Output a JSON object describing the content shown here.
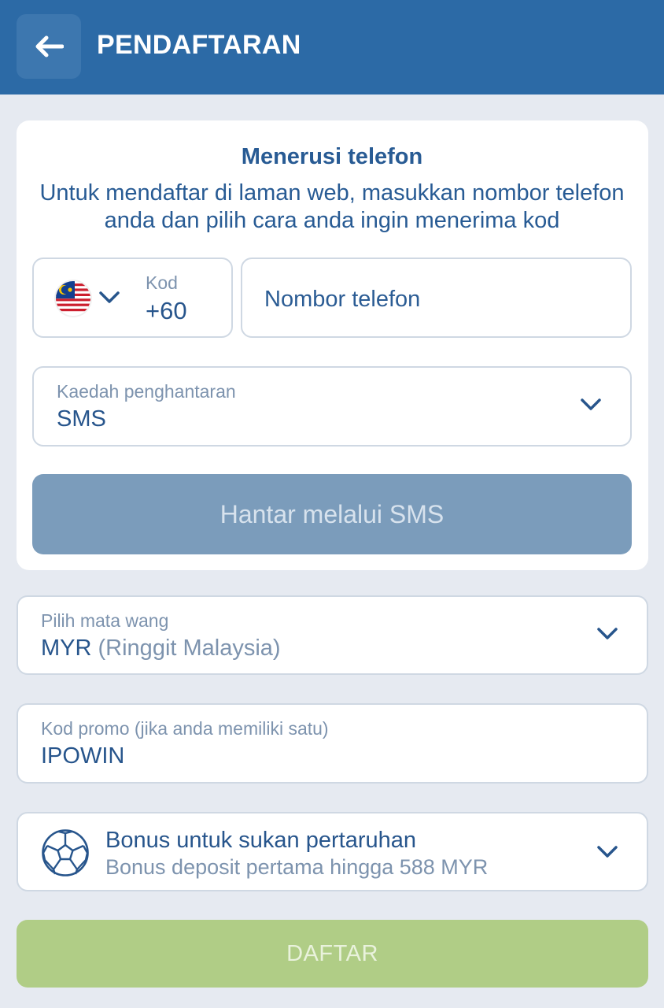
{
  "header": {
    "title": "PENDAFTARAN",
    "back_icon": "arrow-left-icon"
  },
  "phone_section": {
    "title": "Menerusi telefon",
    "description": "Untuk mendaftar di laman web, masukkan nombor telefon anda dan pilih cara anda ingin menerima kod",
    "country_code": {
      "label": "Kod",
      "value": "+60",
      "flag": "malaysia-flag-icon"
    },
    "phone_input": {
      "placeholder": "Nombor telefon",
      "value": ""
    },
    "delivery": {
      "label": "Kaedah penghantaran",
      "value": "SMS"
    },
    "send_button": "Hantar melalui SMS"
  },
  "currency": {
    "label": "Pilih mata wang",
    "code": "MYR",
    "name": "(Ringgit Malaysia)"
  },
  "promo": {
    "label": "Kod promo (jika anda memiliki satu)",
    "value": "IPOWIN"
  },
  "bonus": {
    "title": "Bonus untuk sukan pertaruhan",
    "subtitle": "Bonus deposit pertama hingga 588 MYR",
    "icon": "soccer-ball-icon"
  },
  "register_button": "DAFTAR",
  "colors": {
    "header": "#2c6aa6",
    "background": "#e6eaf1",
    "text": "#27558c",
    "muted": "#7d93ae",
    "send_button": "#7b9cbb",
    "register_button": "#b0cd86"
  }
}
